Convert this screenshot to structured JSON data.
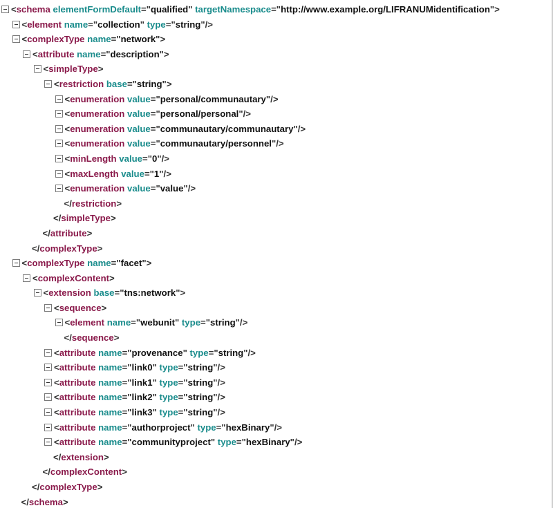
{
  "colors": {
    "tag": "#8a1a4b",
    "attribute": "#1a8c8c",
    "bracket": "#333333",
    "value": "#111111",
    "toggle_border": "#7a7a7a"
  },
  "icons": {
    "toggle": "collapse-minus-icon"
  },
  "lines": [
    {
      "depth": 0,
      "toggle": true,
      "closing": false,
      "tag": "schema",
      "attrs": [
        {
          "name": "elementFormDefault",
          "value": "qualified"
        },
        {
          "name": "targetNamespace",
          "value": "http://www.example.org/LIFRANUMidentification"
        }
      ],
      "end": ">"
    },
    {
      "depth": 1,
      "toggle": true,
      "closing": false,
      "tag": "element",
      "attrs": [
        {
          "name": "name",
          "value": "collection"
        },
        {
          "name": "type",
          "value": "string"
        }
      ],
      "end": "/>"
    },
    {
      "depth": 1,
      "toggle": true,
      "closing": false,
      "tag": "complexType",
      "attrs": [
        {
          "name": "name",
          "value": "network"
        }
      ],
      "end": ">"
    },
    {
      "depth": 2,
      "toggle": true,
      "closing": false,
      "tag": "attribute",
      "attrs": [
        {
          "name": "name",
          "value": "description"
        }
      ],
      "end": ">"
    },
    {
      "depth": 3,
      "toggle": true,
      "closing": false,
      "tag": "simpleType",
      "attrs": [],
      "end": ">"
    },
    {
      "depth": 4,
      "toggle": true,
      "closing": false,
      "tag": "restriction",
      "attrs": [
        {
          "name": "base",
          "value": "string"
        }
      ],
      "end": ">"
    },
    {
      "depth": 5,
      "toggle": true,
      "closing": false,
      "tag": "enumeration",
      "attrs": [
        {
          "name": "value",
          "value": "personal/communautary"
        }
      ],
      "end": "/>"
    },
    {
      "depth": 5,
      "toggle": true,
      "closing": false,
      "tag": "enumeration",
      "attrs": [
        {
          "name": "value",
          "value": "personal/personal"
        }
      ],
      "end": "/>"
    },
    {
      "depth": 5,
      "toggle": true,
      "closing": false,
      "tag": "enumeration",
      "attrs": [
        {
          "name": "value",
          "value": "communautary/communautary"
        }
      ],
      "end": "/>"
    },
    {
      "depth": 5,
      "toggle": true,
      "closing": false,
      "tag": "enumeration",
      "attrs": [
        {
          "name": "value",
          "value": "communautary/personnel"
        }
      ],
      "end": "/>"
    },
    {
      "depth": 5,
      "toggle": true,
      "closing": false,
      "tag": "minLength",
      "attrs": [
        {
          "name": "value",
          "value": "0"
        }
      ],
      "end": "/>"
    },
    {
      "depth": 5,
      "toggle": true,
      "closing": false,
      "tag": "maxLength",
      "attrs": [
        {
          "name": "value",
          "value": "1"
        }
      ],
      "end": "/>"
    },
    {
      "depth": 5,
      "toggle": true,
      "closing": false,
      "tag": "enumeration",
      "attrs": [
        {
          "name": "value",
          "value": "value"
        }
      ],
      "end": "/>"
    },
    {
      "depth": 5,
      "toggle": false,
      "closing": true,
      "tag": "restriction",
      "attrs": [],
      "end": ">"
    },
    {
      "depth": 4,
      "toggle": false,
      "closing": true,
      "tag": "simpleType",
      "attrs": [],
      "end": ">"
    },
    {
      "depth": 3,
      "toggle": false,
      "closing": true,
      "tag": "attribute",
      "attrs": [],
      "end": ">"
    },
    {
      "depth": 2,
      "toggle": false,
      "closing": true,
      "tag": "complexType",
      "attrs": [],
      "end": ">"
    },
    {
      "depth": 1,
      "toggle": true,
      "closing": false,
      "tag": "complexType",
      "attrs": [
        {
          "name": "name",
          "value": "facet"
        }
      ],
      "end": ">"
    },
    {
      "depth": 2,
      "toggle": true,
      "closing": false,
      "tag": "complexContent",
      "attrs": [],
      "end": ">"
    },
    {
      "depth": 3,
      "toggle": true,
      "closing": false,
      "tag": "extension",
      "attrs": [
        {
          "name": "base",
          "value": "tns:network"
        }
      ],
      "end": ">"
    },
    {
      "depth": 4,
      "toggle": true,
      "closing": false,
      "tag": "sequence",
      "attrs": [],
      "end": ">"
    },
    {
      "depth": 5,
      "toggle": true,
      "closing": false,
      "tag": "element",
      "attrs": [
        {
          "name": "name",
          "value": "webunit"
        },
        {
          "name": "type",
          "value": "string"
        }
      ],
      "end": "/>"
    },
    {
      "depth": 5,
      "toggle": false,
      "closing": true,
      "tag": "sequence",
      "attrs": [],
      "end": ">"
    },
    {
      "depth": 4,
      "toggle": true,
      "closing": false,
      "tag": "attribute",
      "attrs": [
        {
          "name": "name",
          "value": "provenance"
        },
        {
          "name": "type",
          "value": "string"
        }
      ],
      "end": "/>"
    },
    {
      "depth": 4,
      "toggle": true,
      "closing": false,
      "tag": "attribute",
      "attrs": [
        {
          "name": "name",
          "value": "link0"
        },
        {
          "name": "type",
          "value": "string"
        }
      ],
      "end": "/>"
    },
    {
      "depth": 4,
      "toggle": true,
      "closing": false,
      "tag": "attribute",
      "attrs": [
        {
          "name": "name",
          "value": "link1"
        },
        {
          "name": "type",
          "value": "string"
        }
      ],
      "end": "/>"
    },
    {
      "depth": 4,
      "toggle": true,
      "closing": false,
      "tag": "attribute",
      "attrs": [
        {
          "name": "name",
          "value": "link2"
        },
        {
          "name": "type",
          "value": "string"
        }
      ],
      "end": "/>"
    },
    {
      "depth": 4,
      "toggle": true,
      "closing": false,
      "tag": "attribute",
      "attrs": [
        {
          "name": "name",
          "value": "link3"
        },
        {
          "name": "type",
          "value": "string"
        }
      ],
      "end": "/>"
    },
    {
      "depth": 4,
      "toggle": true,
      "closing": false,
      "tag": "attribute",
      "attrs": [
        {
          "name": "name",
          "value": "authorproject"
        },
        {
          "name": "type",
          "value": "hexBinary"
        }
      ],
      "end": "/>"
    },
    {
      "depth": 4,
      "toggle": true,
      "closing": false,
      "tag": "attribute",
      "attrs": [
        {
          "name": "name",
          "value": "communityproject"
        },
        {
          "name": "type",
          "value": "hexBinary"
        }
      ],
      "end": "/>"
    },
    {
      "depth": 4,
      "toggle": false,
      "closing": true,
      "tag": "extension",
      "attrs": [],
      "end": ">"
    },
    {
      "depth": 3,
      "toggle": false,
      "closing": true,
      "tag": "complexContent",
      "attrs": [],
      "end": ">"
    },
    {
      "depth": 2,
      "toggle": false,
      "closing": true,
      "tag": "complexType",
      "attrs": [],
      "end": ">"
    },
    {
      "depth": 1,
      "toggle": false,
      "closing": true,
      "tag": "schema",
      "attrs": [],
      "end": ">"
    }
  ]
}
